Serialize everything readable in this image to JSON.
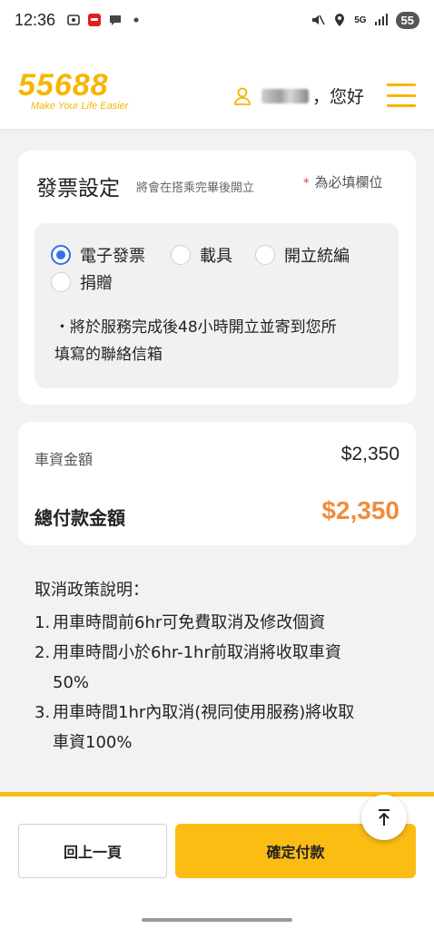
{
  "status_bar": {
    "time": "12:36",
    "network": "5G",
    "battery": "55",
    "icons": [
      "screenshot-icon",
      "app-notification-icon",
      "chat-icon",
      "dot-icon",
      "mute-icon",
      "location-icon",
      "signal-icon"
    ]
  },
  "header": {
    "logo_text": "55688",
    "logo_tagline": "Make Your Life Easier",
    "greeting": "，您好",
    "icons": [
      "user-icon",
      "hamburger-menu-icon"
    ]
  },
  "invoice": {
    "title": "發票設定",
    "subtitle": "將會在搭乘完畢後開立",
    "required_star": "*",
    "required_note": "為必填欄位",
    "options": [
      {
        "label": "電子發票",
        "checked": true
      },
      {
        "label": "載具",
        "checked": false
      },
      {
        "label": "開立統編",
        "checked": false
      },
      {
        "label": "捐贈",
        "checked": false
      }
    ],
    "note_line1": "・將於服務完成後48小時開立並寄到您所",
    "note_line2": "填寫的聯絡信箱"
  },
  "price": {
    "fare_label": "車資金額",
    "fare_value": "$2,350",
    "total_label": "總付款金額",
    "total_value": "$2,350",
    "total_color": "#f08c3a"
  },
  "policy": {
    "title": "取消政策說明：",
    "items": [
      {
        "num": "1.",
        "line1": "用車時間前6hr可免費取消及修改個資",
        "line2": ""
      },
      {
        "num": "2.",
        "line1": "用車時間小於6hr-1hr前取消將收取車資",
        "line2": "50%"
      },
      {
        "num": "3.",
        "line1": "用車時間1hr內取消(視同使用服務)將收取",
        "line2": "車資100%"
      }
    ]
  },
  "actions": {
    "back_label": "回上一頁",
    "confirm_label": "確定付款",
    "accent_color": "#fbbd14"
  }
}
